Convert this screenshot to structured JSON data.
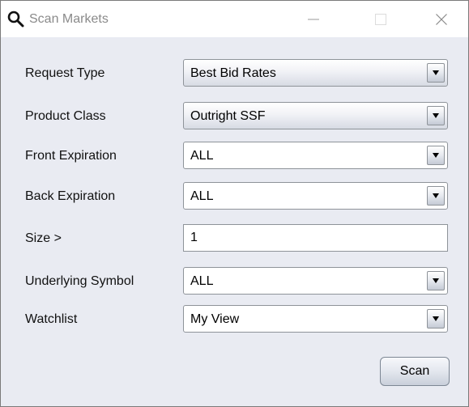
{
  "window": {
    "title": "Scan Markets",
    "icons": {
      "app": "magnifier-icon",
      "minimize": "minimize-icon",
      "maximize": "maximize-icon",
      "close": "close-icon"
    }
  },
  "form": {
    "request_type": {
      "label": "Request Type",
      "value": "Best Bid Rates"
    },
    "product_class": {
      "label": "Product Class",
      "value": "Outright SSF"
    },
    "front_expiration": {
      "label": "Front Expiration",
      "value": "ALL"
    },
    "back_expiration": {
      "label": "Back Expiration",
      "value": "ALL"
    },
    "size": {
      "label": "Size >",
      "value": "1"
    },
    "underlying_symbol": {
      "label": "Underlying Symbol",
      "value": "ALL"
    },
    "watchlist": {
      "label": "Watchlist",
      "value": "My View"
    }
  },
  "actions": {
    "scan_label": "Scan"
  },
  "colors": {
    "window_background": "#e9ebf2",
    "titlebar_background": "#ffffff",
    "title_text": "#8a8a8a",
    "control_border": "#8e9399"
  }
}
